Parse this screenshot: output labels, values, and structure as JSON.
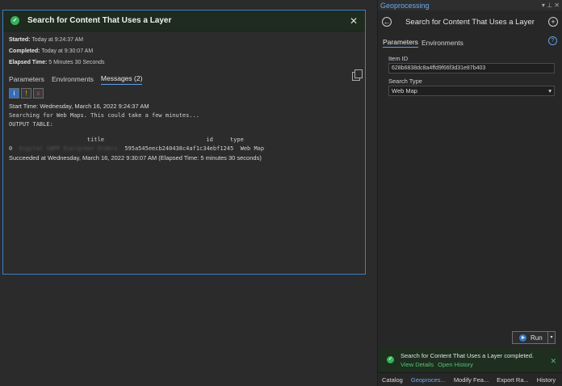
{
  "popup": {
    "title": "Search for Content That Uses a Layer",
    "started_label": "Started:",
    "started_value": "Today at 9:24:37 AM",
    "completed_label": "Completed:",
    "completed_value": "Today at 9:30:07 AM",
    "elapsed_label": "Elapsed Time:",
    "elapsed_value": "5 Minutes 30 Seconds",
    "tabs": [
      "Parameters",
      "Environments",
      "Messages (2)"
    ],
    "filters": {
      "info": "i",
      "warn": "!",
      "err": "x"
    },
    "messages": {
      "start_time": "Start Time: Wednesday, March 16, 2022 9:24:37 AM",
      "searching": "Searching for Web Maps. This could take a few minutes...",
      "output_table": "OUTPUT TABLE:",
      "table_header": "                       title                              id     type",
      "row_index": "0",
      "row_title_blurred": "Digital SWPP Evergreen Orders",
      "row_rest": "595a545eecb240438c4af1c34ebf1245  Web Map",
      "succeeded": "Succeeded at Wednesday, March 16, 2022 9:30:07 AM (Elapsed Time: 5 minutes 30 seconds)"
    }
  },
  "gp": {
    "pane_title": "Geoprocessing",
    "pin": "▾ ⊥ ✕",
    "back": "←",
    "add": "+",
    "tool_name": "Search for Content That Uses a Layer",
    "tabs": [
      "Parameters",
      "Environments"
    ],
    "help": "?",
    "item_id_label": "Item ID",
    "item_id_value": "628b6838dc8a4ffd9f66f3d31e87b403",
    "search_type_label": "Search Type",
    "search_type_value": "Web Map",
    "select_arrow": "▾",
    "run_label": "Run",
    "run_arrow": "▾",
    "notice_text": "Search for Content That Uses a Layer completed.",
    "view_details": "View Details",
    "open_history": "Open History",
    "notice_close": "✕",
    "bottom_tabs": [
      "Catalog",
      "Geoproces...",
      "Modify Fea...",
      "Export Ra...",
      "History"
    ]
  }
}
